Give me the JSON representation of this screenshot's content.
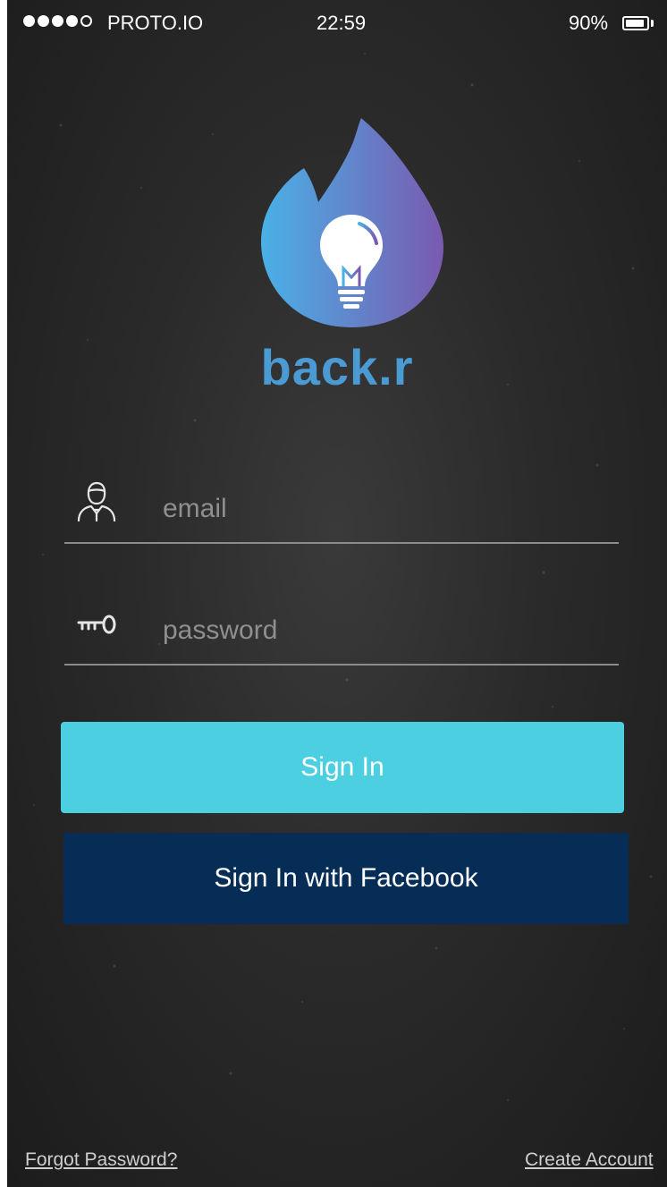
{
  "status_bar": {
    "carrier": "PROTO.IO",
    "time": "22:59",
    "battery": "90%",
    "battery_level": 0.9,
    "signal_bars_filled": 4,
    "signal_bars_total": 5
  },
  "brand": {
    "name": "back.r",
    "logo_icon": "flame-lightbulb-icon",
    "name_color": "#4a9ad4",
    "logo_gradient": [
      "#4ab0e6",
      "#7a5ab0"
    ]
  },
  "form": {
    "email": {
      "placeholder": "email",
      "value": "",
      "icon": "user-icon"
    },
    "password": {
      "placeholder": "password",
      "value": "",
      "icon": "key-icon"
    }
  },
  "buttons": {
    "sign_in": "Sign In",
    "sign_in_facebook": "Sign In with Facebook",
    "sign_in_color": "#4dcfe2",
    "facebook_color": "#052d56"
  },
  "footer": {
    "forgot_password": "Forgot Password?",
    "create_account": "Create Account"
  }
}
